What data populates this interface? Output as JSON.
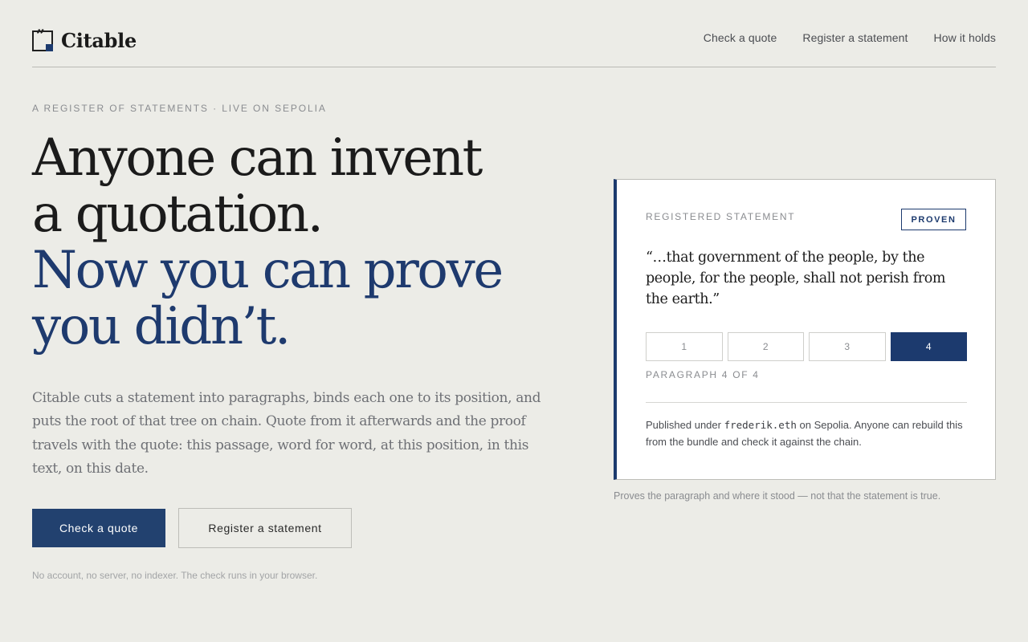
{
  "brand": {
    "name": "Citable",
    "logo_icon": "quote-box-icon",
    "logo_glyph": "”"
  },
  "nav": {
    "items": [
      "Check a quote",
      "Register a statement",
      "How it holds"
    ]
  },
  "hero": {
    "eyebrow": "A REGISTER OF STATEMENTS · LIVE ON SEPOLIA",
    "headline_lines": [
      "Anyone can invent",
      "a quotation."
    ],
    "headline_accent_lines": [
      "Now you can prove",
      "you didn’t."
    ],
    "lead": "Citable cuts a statement into paragraphs, binds each one to its position, and puts the root of that tree on chain. Quote from it afterwards and the proof travels with the quote: this passage, word for word, at this position, in this text, on this date.",
    "primary_button": "Check a quote",
    "secondary_button": "Register a statement",
    "footnote": "No account, no server, no indexer. The check runs in your browser."
  },
  "card": {
    "label": "REGISTERED STATEMENT",
    "badge": "PROVEN",
    "quote": "“…that government of the people, by the people, for the people, shall not perish from the earth.”",
    "paragraphs": [
      "1",
      "2",
      "3",
      "4"
    ],
    "selected_paragraph": 4,
    "paragraph_status": "PARAGRAPH 4 OF 4",
    "published_prefix": "Published under ",
    "published_handle": "frederik.eth",
    "published_suffix": " on Sepolia. Anyone can rebuild this from the bundle and check it against the chain.",
    "caption": "Proves the paragraph and where it stood — not that the statement is true."
  },
  "colors": {
    "background": "#ecece7",
    "accent": "#1c3a6e",
    "text": "#1b1b1b",
    "muted": "#8a8c90"
  }
}
